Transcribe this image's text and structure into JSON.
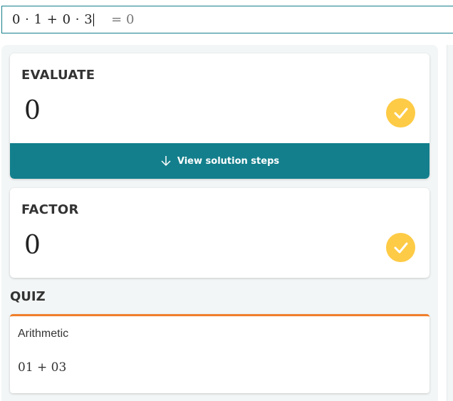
{
  "input": {
    "expression": "0 · 1 + 0 · 3",
    "result": "= 0"
  },
  "evaluate": {
    "heading": "EVALUATE",
    "value": "0",
    "steps_label": "View solution steps",
    "check_icon": "check-icon",
    "arrow_icon": "arrow-down-icon"
  },
  "factor": {
    "heading": "FACTOR",
    "value": "0",
    "check_icon": "check-icon"
  },
  "quiz": {
    "heading": "QUIZ",
    "topic": "Arithmetic",
    "expression": "01 + 03"
  },
  "colors": {
    "accent_teal": "#137f8c",
    "check_yellow": "#fecb46",
    "quiz_orange": "#f07f2a"
  }
}
